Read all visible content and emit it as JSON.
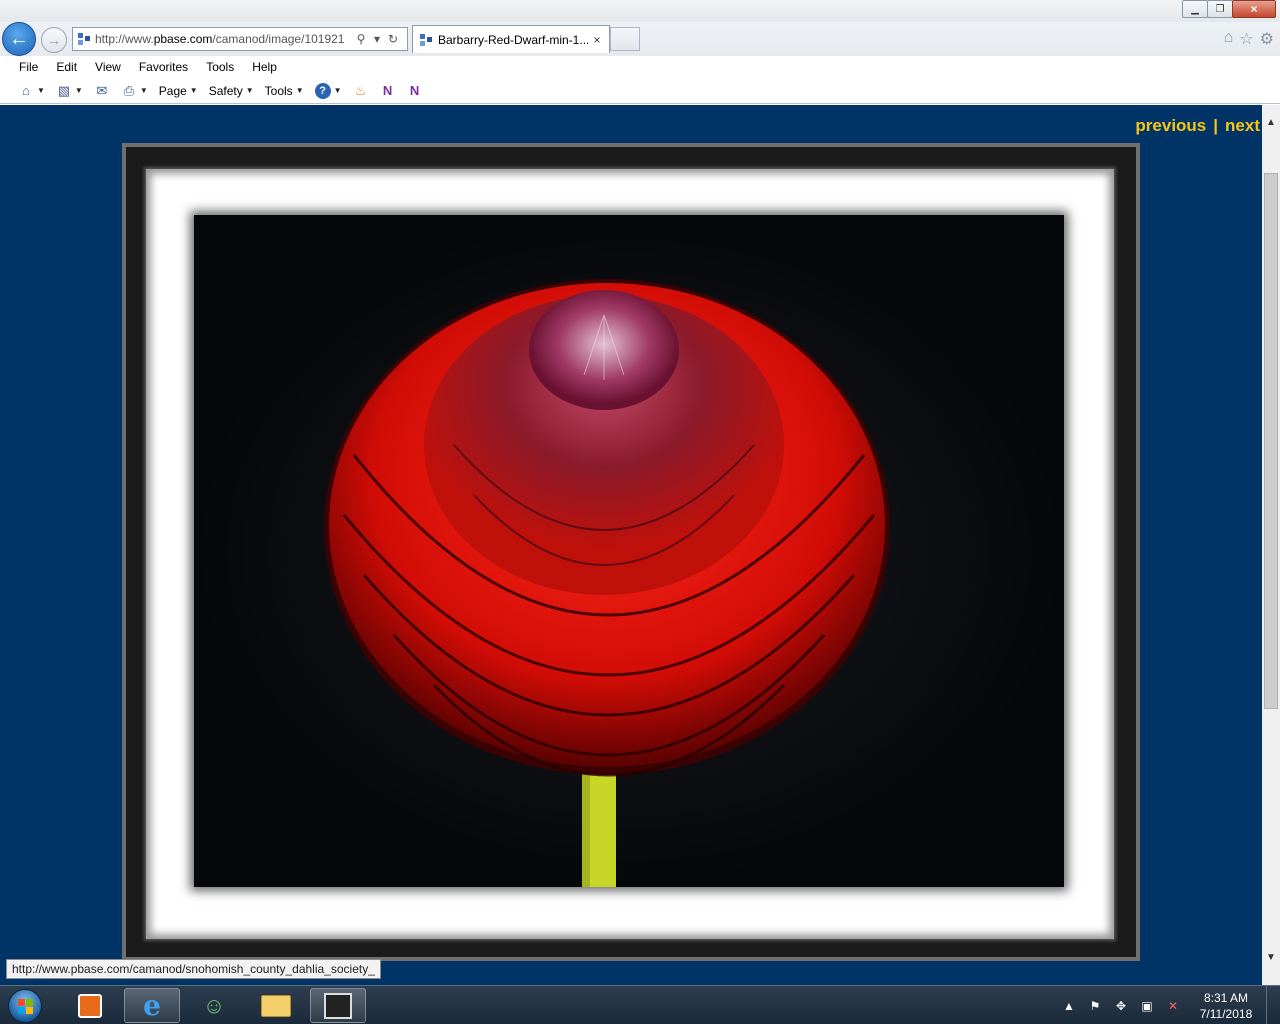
{
  "browser": {
    "address_url_prefix": "http://www.",
    "address_url_domain": "pbase.com",
    "address_url_rest": "/camanod/image/101921",
    "tab_title": "Barbarry-Red-Dwarf-min-1....",
    "tab_close": "×",
    "window_close": "×"
  },
  "menu": [
    "File",
    "Edit",
    "View",
    "Favorites",
    "Tools",
    "Help"
  ],
  "commands": {
    "page": "Page",
    "safety": "Safety",
    "tools": "Tools"
  },
  "page": {
    "previous": "previous",
    "separator": "|",
    "next": "next",
    "background_color": "#003366",
    "link_color": "#f5c518"
  },
  "status": {
    "hover_url": "http://www.pbase.com/camanod/snohomish_county_dahlia_society_"
  },
  "taskbar": {
    "time": "8:31 AM",
    "date": "7/11/2018"
  },
  "icons": {
    "back": "back-arrow-icon",
    "forward": "forward-arrow-icon",
    "home": "home-icon",
    "favorites": "star-icon",
    "settings": "gear-icon"
  }
}
